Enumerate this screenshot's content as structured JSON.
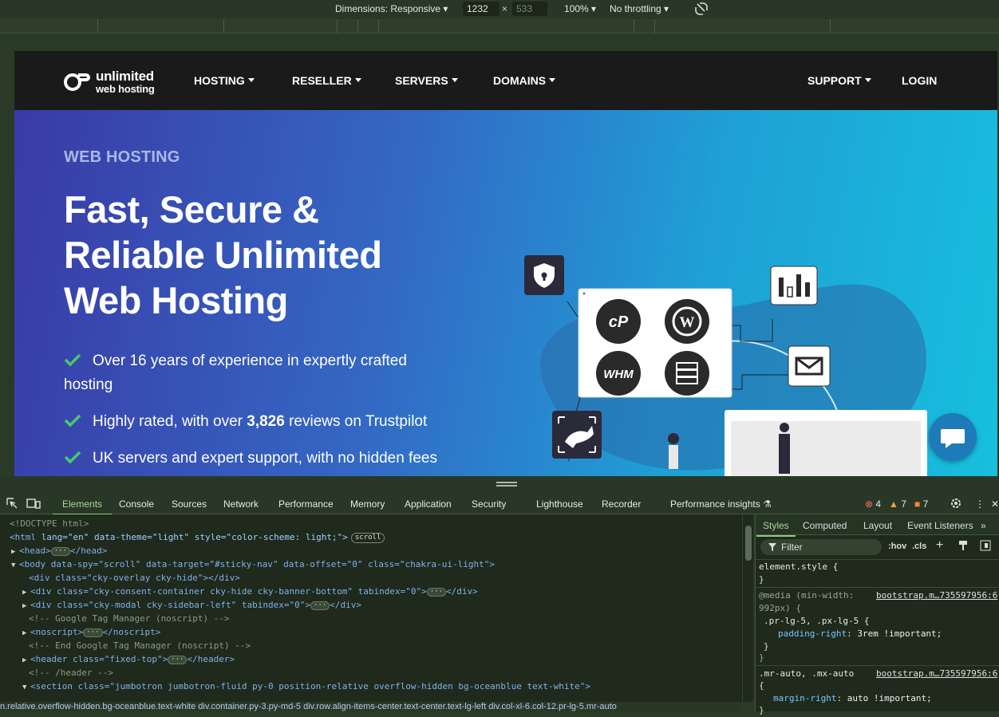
{
  "devbar": {
    "dimensions": "Dimensions: Responsive",
    "width": "1232",
    "height": "533",
    "zoom": "100%",
    "throttle": "No throttling"
  },
  "site": {
    "logo_line1": "unlimited",
    "logo_line2": "web hosting",
    "nav": [
      "HOSTING",
      "RESELLER",
      "SERVERS",
      "DOMAINS"
    ],
    "support": "SUPPORT",
    "login": "LOGIN",
    "eyebrow": "WEB HOSTING",
    "headline": [
      "Fast, Secure &",
      "Reliable Unlimited",
      "Web Hosting"
    ],
    "bullets": {
      "b1_line1": "Over 16 years of experience in expertly crafted",
      "b1_line2": "hosting",
      "b2_pre": "Highly rated, with over ",
      "b2_bold": "3,826",
      "b2_post": " reviews on Trustpilot",
      "b3": "UK servers and expert support, with no hidden fees"
    },
    "colors": {
      "accent_green": "#4cc76a",
      "nav_bg": "#1a1a1a",
      "chat_bg": "#1e7ab8"
    }
  },
  "devtools": {
    "tabs": [
      "Elements",
      "Console",
      "Sources",
      "Network",
      "Performance",
      "Memory",
      "Application",
      "Security",
      "Lighthouse",
      "Recorder",
      "Performance insights"
    ],
    "errors": "4",
    "warnings": "7",
    "issues": "7",
    "dom": {
      "l1": "<!DOCTYPE html>",
      "l2_tag_open": "<html",
      "l2_attrs": " lang=\"en\" data-theme=\"light\" style=\"color-scheme: light;\">",
      "l2_pill": "scroll",
      "l3": "<head>",
      "l3_close": "</head>",
      "l4": "<body data-spy=\"scroll\" data-target=\"#sticky-nav\" data-offset=\"0\" class=\"chakra-ui-light\">",
      "l5": "<div class=\"cky-overlay cky-hide\"></div>",
      "l6": "<div class=\"cky-consent-container cky-hide cky-banner-bottom\" tabindex=\"0\">",
      "l6_close": "</div>",
      "l7": "<div class=\"cky-modal cky-sidebar-left\" tabindex=\"0\">",
      "l7_close": "</div>",
      "l8": "<!-- Google Tag Manager (noscript) -->",
      "l9": "<noscript>",
      "l9_close": "</noscript>",
      "l10": "<!-- End Google Tag Manager (noscript) -->",
      "l11": "<header class=\"fixed-top\">",
      "l11_close": "</header>",
      "l12": "<!-- /header -->",
      "l13": "<section class=\"jumbotron jumbotron-fluid py-0 position-relative overflow-hidden bg-oceanblue text-white\">"
    },
    "breadcrumbs": "n.relative.overflow-hidden.bg-oceanblue.text-white   div.container.py-3.py-md-5   div.row.align-items-center.text-center.text-lg-left   div.col-xl-6.col-12.pr-lg-5.mr-auto",
    "styles_tabs": [
      "Styles",
      "Computed",
      "Layout",
      "Event Listeners"
    ],
    "filter_placeholder": "Filter",
    "hov": ":hov",
    "cls": ".cls",
    "rules": {
      "r1_sel": "element.style {",
      "r1_close": "}",
      "r2_media": "@media (min-width:",
      "r2_src": "bootstrap.m…735597956:6",
      "r2_media2": "992px) {",
      "r2_sel": ".pr-lg-5, .px-lg-5 {",
      "r2_prop": "padding-right",
      "r2_val": "3rem !important;",
      "r2_close": "}",
      "r2_close2": "}",
      "r3_sel": ".mr-auto, .mx-auto",
      "r3_src": "bootstrap.m…735597956:6",
      "r3_open": "{",
      "r3_prop": "margin-right",
      "r3_val": "auto !important;",
      "r3_close": "}"
    }
  }
}
